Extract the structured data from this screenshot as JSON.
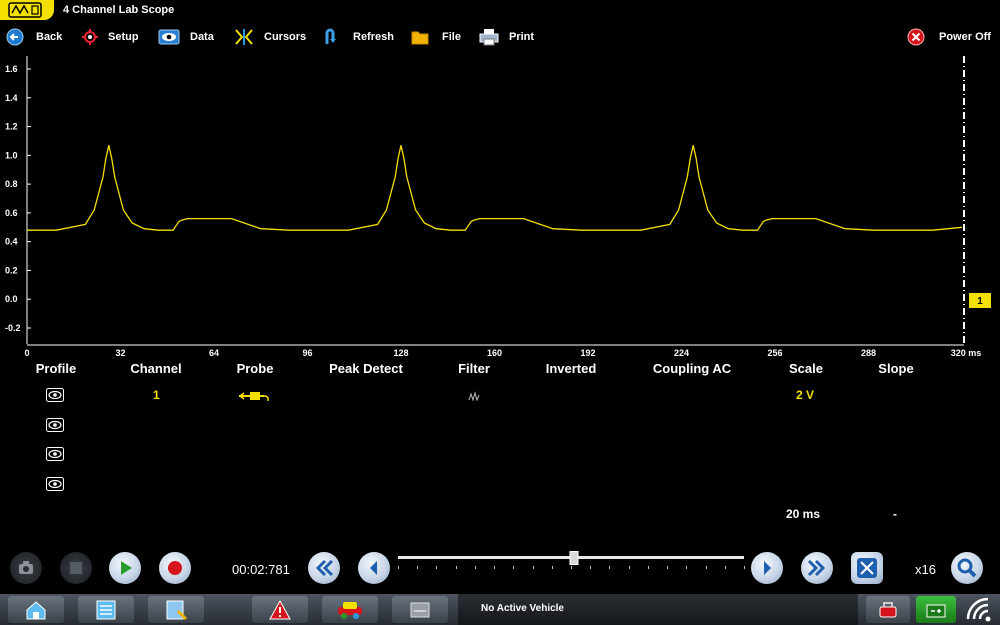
{
  "window": {
    "title": "4 Channel Lab Scope"
  },
  "toolbar": {
    "back": "Back",
    "setup": "Setup",
    "data": "Data",
    "cursors": "Cursors",
    "refresh": "Refresh",
    "file": "File",
    "print": "Print",
    "power_off": "Power Off"
  },
  "colors": {
    "trace": "#f4e000",
    "accent": "#1f7bd0",
    "record": "#d6141c",
    "play": "#2a9a2a"
  },
  "y_axis_labels": [
    "1.6",
    "1.4",
    "1.2",
    "1.0",
    "0.8",
    "0.6",
    "0.4",
    "0.2",
    "0.0",
    "-0.2"
  ],
  "x_axis_labels": [
    "0",
    "32",
    "64",
    "96",
    "128",
    "160",
    "192",
    "224",
    "256",
    "288",
    "320 ms"
  ],
  "channel_marker": "1",
  "table": {
    "headers": [
      "Profile",
      "Channel",
      "Probe",
      "Peak Detect",
      "Filter",
      "Inverted",
      "Coupling AC",
      "Scale",
      "Slope"
    ],
    "row": {
      "channel": "1",
      "scale": "2 V"
    }
  },
  "timebase": "20 ms",
  "slope_value": "-",
  "playback": {
    "time": "00:02:781",
    "zoom": "x16",
    "position": 0.51
  },
  "status": {
    "vehicle": "No Active Vehicle"
  },
  "chart_data": {
    "type": "line",
    "x_unit": "ms",
    "xlim": [
      0,
      320
    ],
    "ylim": [
      -0.25,
      1.65
    ],
    "series": [
      {
        "x": [
          0,
          10,
          20,
          23,
          26,
          27,
          28,
          29,
          30,
          33,
          36,
          40,
          45,
          50,
          51,
          52,
          53,
          55,
          57,
          60,
          65,
          70,
          80,
          90,
          96,
          110,
          120,
          123,
          126,
          127,
          128,
          129,
          130,
          133,
          136,
          140,
          145,
          150,
          151,
          152,
          153,
          155,
          157,
          160,
          165,
          170,
          180,
          190,
          196,
          210,
          220,
          223,
          226,
          227,
          228,
          229,
          230,
          233,
          236,
          240,
          245,
          250,
          251,
          252,
          253,
          255,
          257,
          260,
          265,
          270,
          280,
          290,
          296,
          310,
          320
        ],
        "y": [
          0.48,
          0.48,
          0.52,
          0.62,
          0.85,
          0.98,
          1.07,
          0.98,
          0.85,
          0.62,
          0.53,
          0.49,
          0.48,
          0.48,
          0.51,
          0.54,
          0.55,
          0.56,
          0.56,
          0.56,
          0.56,
          0.56,
          0.49,
          0.48,
          0.48,
          0.48,
          0.52,
          0.62,
          0.85,
          0.98,
          1.07,
          0.98,
          0.85,
          0.62,
          0.53,
          0.49,
          0.48,
          0.48,
          0.51,
          0.54,
          0.55,
          0.56,
          0.56,
          0.56,
          0.56,
          0.56,
          0.49,
          0.48,
          0.48,
          0.48,
          0.52,
          0.62,
          0.85,
          0.98,
          1.07,
          0.98,
          0.85,
          0.62,
          0.53,
          0.49,
          0.48,
          0.48,
          0.51,
          0.54,
          0.55,
          0.56,
          0.56,
          0.56,
          0.56,
          0.56,
          0.49,
          0.48,
          0.48,
          0.48,
          0.5
        ]
      }
    ]
  }
}
